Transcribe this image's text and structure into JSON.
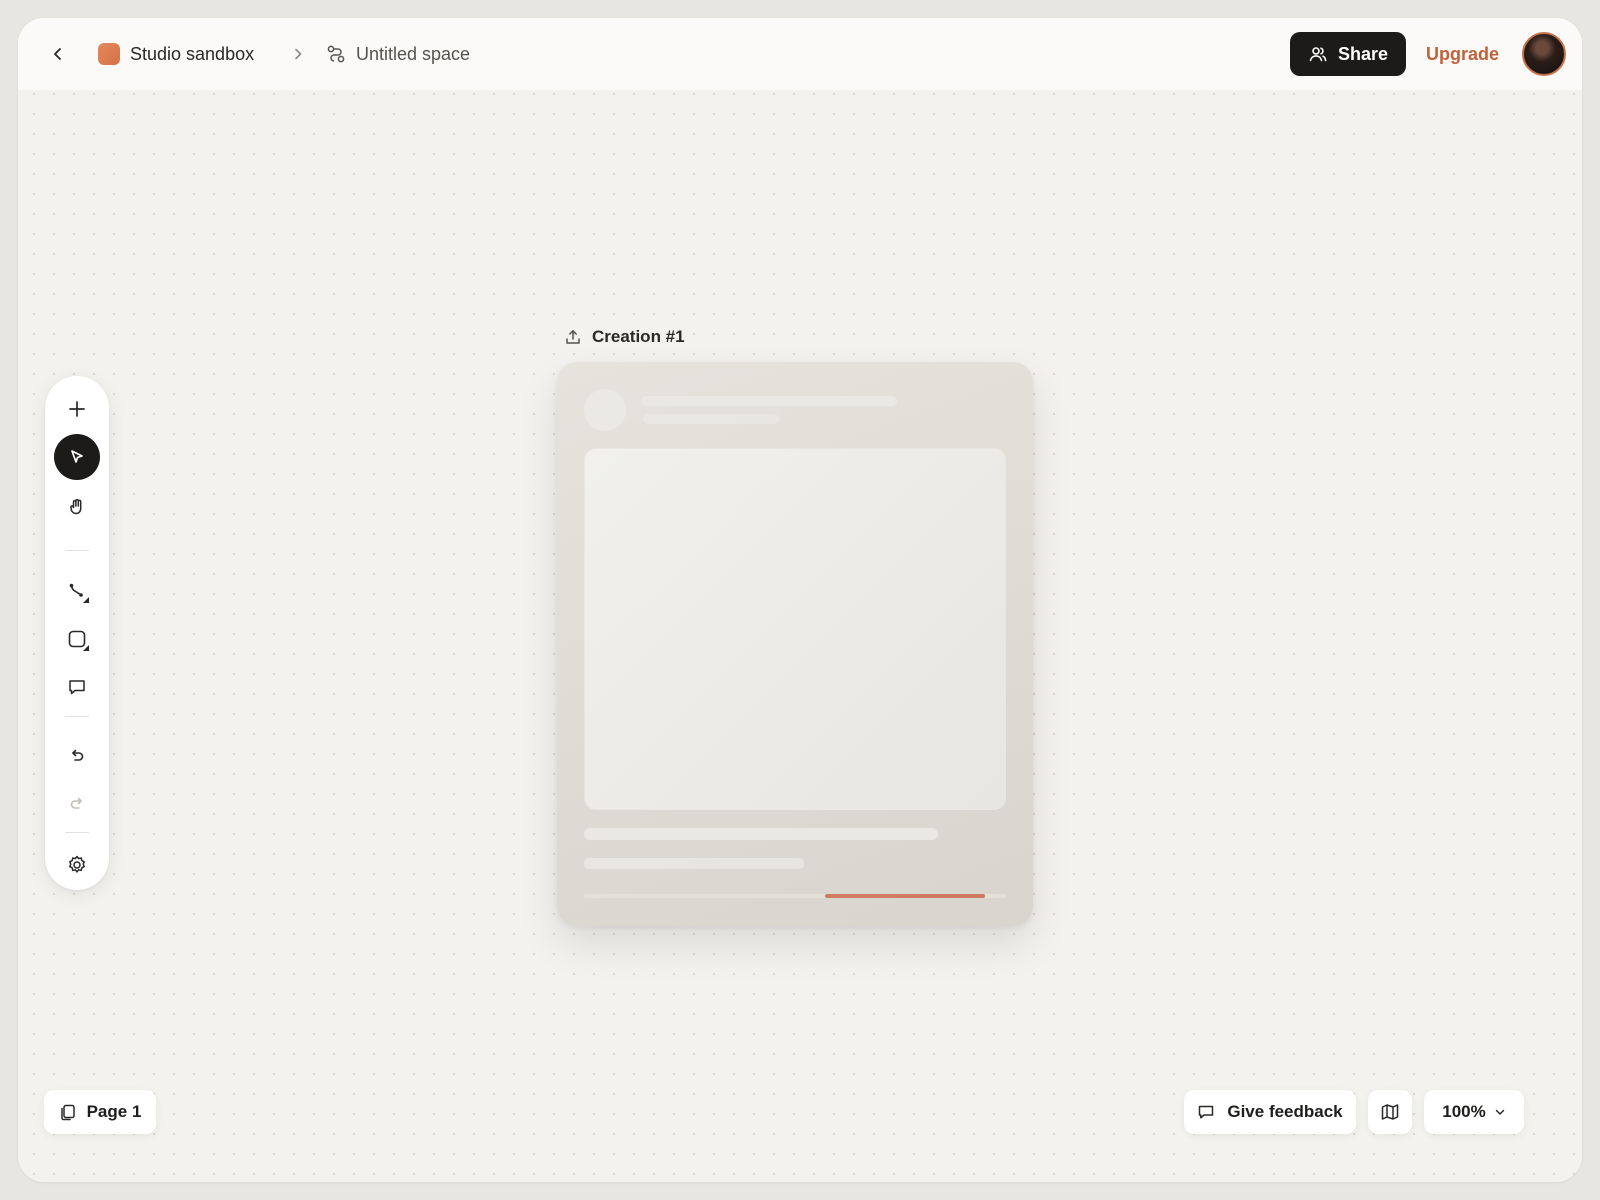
{
  "breadcrumb": {
    "project_name": "Studio sandbox",
    "space_name": "Untitled space"
  },
  "header": {
    "share_label": "Share",
    "upgrade_label": "Upgrade"
  },
  "toolbar": {
    "tools": [
      "plus-icon",
      "cursor-icon",
      "hand-icon",
      "connector-icon",
      "shape-icon",
      "comment-icon",
      "undo-icon",
      "redo-icon",
      "settings-icon"
    ],
    "active_tool": "cursor-icon"
  },
  "canvas": {
    "creation_title": "Creation #1",
    "progress": {
      "start": 0.57,
      "end": 0.95
    }
  },
  "footer": {
    "page_label": "Page 1",
    "feedback_label": "Give feedback",
    "zoom_label": "100%"
  },
  "colors": {
    "accent": "#c0623a",
    "progress": "#cf7d62",
    "dark": "#1c1b1a"
  }
}
